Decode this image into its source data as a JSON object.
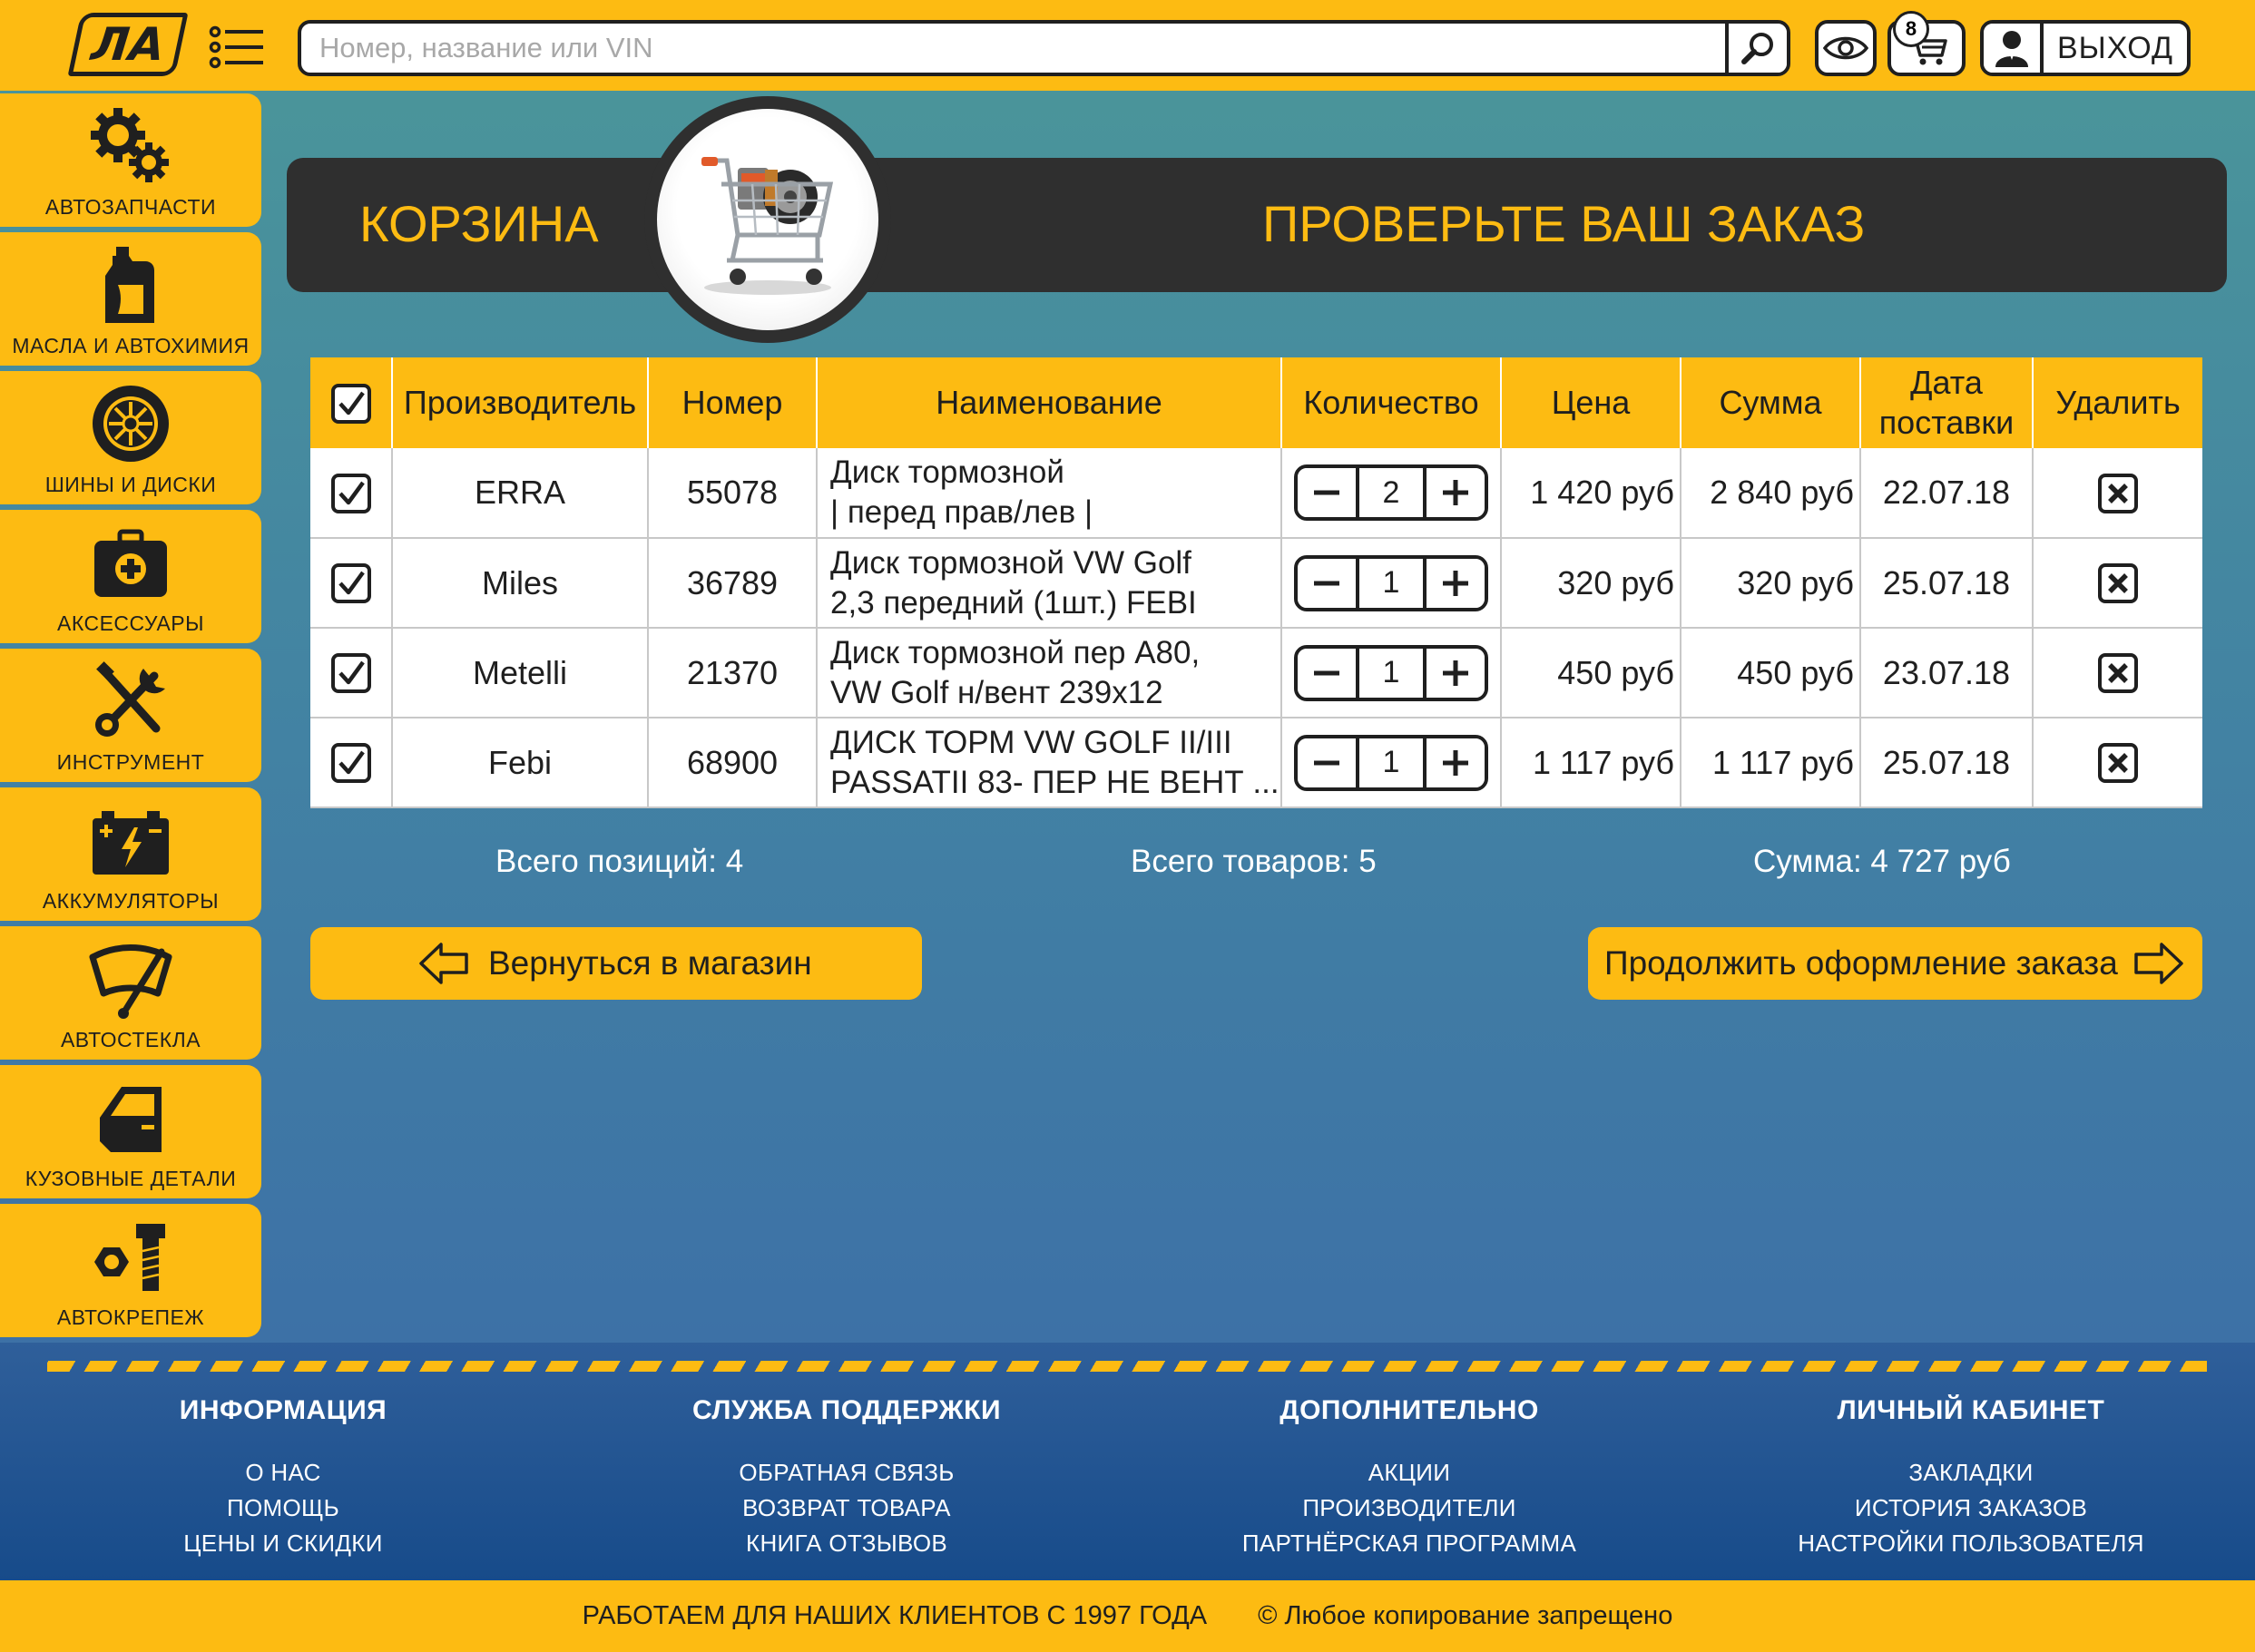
{
  "logo": {
    "text": "ЛА"
  },
  "search": {
    "placeholder": "Номер, название или VIN"
  },
  "cart": {
    "badge": "8"
  },
  "account": {
    "logout_label": "ВЫХОД"
  },
  "sidebar": {
    "items": [
      {
        "label": "АВТОЗАПЧАСТИ",
        "icon": "gears-icon"
      },
      {
        "label": "МАСЛА И АВТОХИМИЯ",
        "icon": "oil-canister-icon"
      },
      {
        "label": "ШИНЫ И ДИСКИ",
        "icon": "wheel-icon"
      },
      {
        "label": "АКСЕССУАРЫ",
        "icon": "first-aid-kit-icon"
      },
      {
        "label": "ИНСТРУМЕНТ",
        "icon": "tools-icon"
      },
      {
        "label": "АККУМУЛЯТОРЫ",
        "icon": "battery-icon"
      },
      {
        "label": "АВТОСТЕКЛА",
        "icon": "windshield-wiper-icon"
      },
      {
        "label": "КУЗОВНЫЕ ДЕТАЛИ",
        "icon": "car-door-icon"
      },
      {
        "label": "АВТОКРЕПЕЖ",
        "icon": "bolt-nut-icon"
      }
    ]
  },
  "header": {
    "title": "КОРЗИНА",
    "subtitle": "ПРОВЕРЬТЕ ВАШ ЗАКАЗ"
  },
  "table": {
    "columns": {
      "maker": "Производитель",
      "number": "Номер",
      "name": "Наименование",
      "qty": "Количество",
      "price": "Цена",
      "sum": "Сумма",
      "date_line1": "Дата",
      "date_line2": "поставки",
      "delete": "Удалить"
    },
    "rows": [
      {
        "maker": "ERRA",
        "number": "55078",
        "name_line1": "Диск тормозной",
        "name_line2": "| перед прав/лев |",
        "qty": "2",
        "price": "1 420 руб",
        "sum": "2 840 руб",
        "date": "22.07.18",
        "checked": true
      },
      {
        "maker": "Miles",
        "number": "36789",
        "name_line1": "Диск тормозной VW Golf",
        "name_line2": "2,3 передний (1шт.) FEBI",
        "qty": "1",
        "price": "320 руб",
        "sum": "320 руб",
        "date": "25.07.18",
        "checked": true
      },
      {
        "maker": "Metelli",
        "number": "21370",
        "name_line1": "Диск тормозной пер A80,",
        "name_line2": "VW Golf н/вент 239x12",
        "qty": "1",
        "price": "450 руб",
        "sum": "450 руб",
        "date": "23.07.18",
        "checked": true
      },
      {
        "maker": "Febi",
        "number": "68900",
        "name_line1": "ДИСК ТОРМ VW GOLF II/III",
        "name_line2": "PASSATII 83- ПЕР НЕ ВЕНТ ...",
        "qty": "1",
        "price": "1 117 руб",
        "sum": "1 117 руб",
        "date": "25.07.18",
        "checked": true
      }
    ]
  },
  "totals": {
    "positions": "Всего позиций: 4",
    "items": "Всего товаров: 5",
    "sum": "Сумма: 4 727 руб"
  },
  "actions": {
    "back": "Вернуться в магазин",
    "continue": "Продолжить оформление заказа"
  },
  "footer": {
    "columns": [
      {
        "title": "ИНФОРМАЦИЯ",
        "links": [
          "О НАС",
          "ПОМОЩЬ",
          "ЦЕНЫ И СКИДКИ"
        ]
      },
      {
        "title": "СЛУЖБА ПОДДЕРЖКИ",
        "links": [
          "ОБРАТНАЯ СВЯЗЬ",
          "ВОЗВРАТ ТОВАРА",
          "КНИГА ОТЗЫВОВ"
        ]
      },
      {
        "title": "ДОПОЛНИТЕЛЬНО",
        "links": [
          "АКЦИИ",
          "ПРОИЗВОДИТЕЛИ",
          "ПАРТНЁРСКАЯ ПРОГРАММА"
        ]
      },
      {
        "title": "ЛИЧНЫЙ КАБИНЕТ",
        "links": [
          "ЗАКЛАДКИ",
          "ИСТОРИЯ ЗАКАЗОВ",
          "НАСТРОЙКИ ПОЛЬЗОВАТЕЛЯ"
        ]
      }
    ],
    "since": "РАБОТАЕМ ДЛЯ НАШИХ КЛИЕНТОВ С 1997 ГОДА",
    "copyright": "©  Любое копирование запрещено"
  },
  "colors": {
    "accent": "#fdbb12",
    "dark": "#2f2f2f",
    "footer": "#174b8a"
  }
}
